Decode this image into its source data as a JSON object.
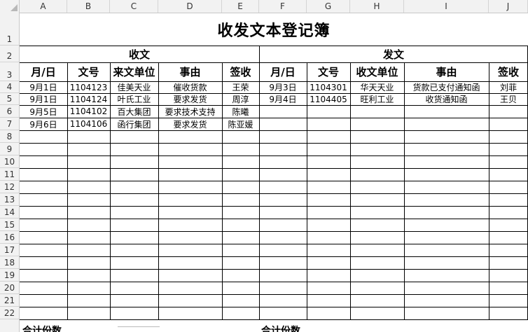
{
  "columns": [
    "A",
    "B",
    "C",
    "D",
    "E",
    "F",
    "G",
    "H",
    "I",
    "J"
  ],
  "rows": [
    "1",
    "2",
    "3",
    "4",
    "5",
    "6",
    "7",
    "8",
    "9",
    "10",
    "11",
    "12",
    "13",
    "14",
    "15",
    "16",
    "17",
    "18",
    "19",
    "20",
    "21",
    "22"
  ],
  "title": "收发文本登记簿",
  "received": {
    "section_label": "收文",
    "headers": [
      "月/日",
      "文号",
      "来文单位",
      "事由",
      "签收"
    ],
    "entries": [
      [
        "9月1日",
        "1104123",
        "佳美天业",
        "催收货款",
        "王荣"
      ],
      [
        "9月1日",
        "1104124",
        "叶氏工业",
        "要求发货",
        "周淳"
      ],
      [
        "9月5日",
        "1104102",
        "百大集团",
        "要求技术支持",
        "陈曦"
      ],
      [
        "9月6日",
        "1104106",
        "函行集团",
        "要求发货",
        "陈亚媛"
      ]
    ]
  },
  "sent": {
    "section_label": "发文",
    "headers": [
      "月/日",
      "文号",
      "收文单位",
      "事由",
      "签收"
    ],
    "entries": [
      [
        "9月3日",
        "1104301",
        "华天天业",
        "货款已支付通知函",
        "刘菲"
      ],
      [
        "9月4日",
        "1104405",
        "旺利工业",
        "收货通知函",
        "王贝"
      ]
    ]
  },
  "footer": {
    "left_label": "合计份数",
    "right_label": "合计份数"
  }
}
